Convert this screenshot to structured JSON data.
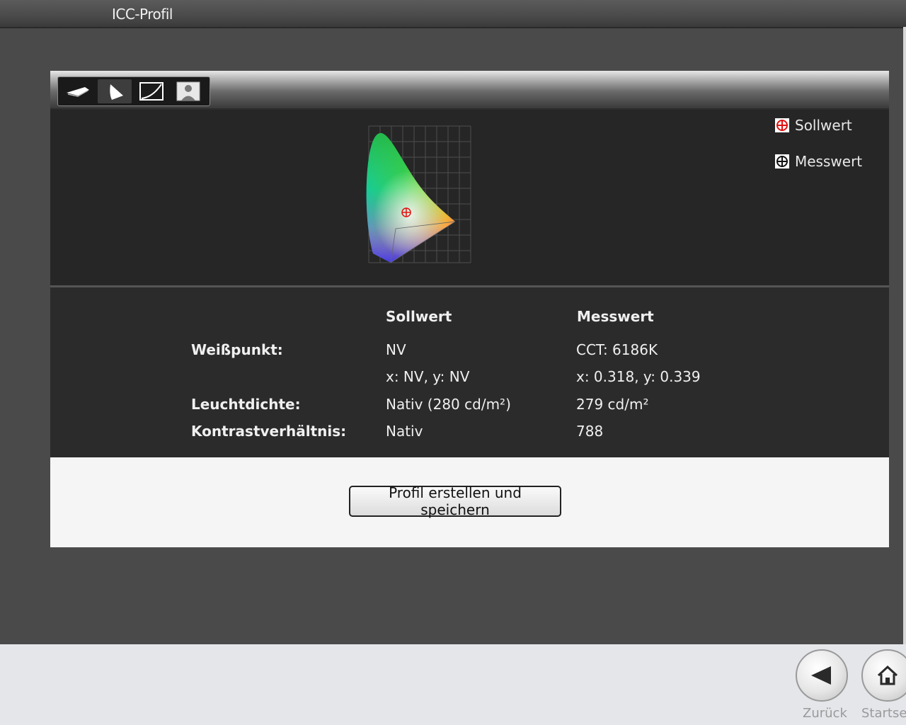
{
  "window": {
    "title": "ICC-Profil"
  },
  "toolbar": {
    "tools": [
      {
        "icon": "display-icon"
      },
      {
        "icon": "gamut-icon",
        "active": true
      },
      {
        "icon": "tone-curve-icon"
      },
      {
        "icon": "person-image-icon"
      }
    ]
  },
  "legend": {
    "target": "Sollwert",
    "measured": "Messwert"
  },
  "table": {
    "col_target": "Sollwert",
    "col_measured": "Messwert",
    "rows": [
      {
        "label": "Weißpunkt:",
        "target": "NV",
        "measured": "CCT: 6186K"
      },
      {
        "label": "",
        "target": "x: NV, y: NV",
        "measured": "x: 0.318, y: 0.339"
      },
      {
        "label": "Leuchtdichte:",
        "target": "Nativ (280 cd/m²)",
        "measured": "279 cd/m²"
      },
      {
        "label": "Kontrastverhältnis:",
        "target": "Nativ",
        "measured": "788"
      }
    ]
  },
  "actions": {
    "create_profile": "Profil erstellen und speichern"
  },
  "nav": {
    "back": "Zurück",
    "home": "Startse"
  },
  "colors": {
    "target_marker": "#e01010",
    "measured_marker": "#ffffff"
  }
}
